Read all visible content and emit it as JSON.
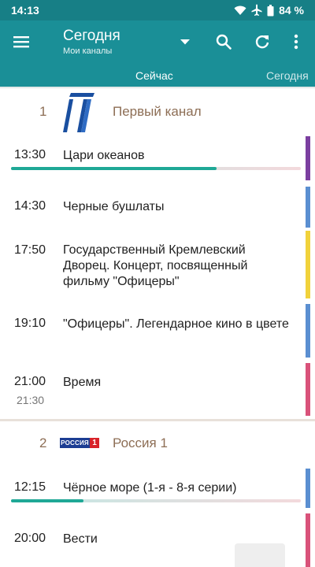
{
  "status_bar": {
    "time": "14:13",
    "battery": "84 %",
    "icons": [
      "wifi-icon",
      "airplane-icon",
      "battery-icon"
    ]
  },
  "app_bar": {
    "title": "Сегодня",
    "subtitle": "Мои каналы",
    "icons": [
      "menu-icon",
      "dropdown-icon",
      "search-icon",
      "refresh-icon",
      "more-icon"
    ]
  },
  "tabs": [
    {
      "label": "Сейчас",
      "selected": true
    },
    {
      "label": "Сегодня",
      "selected": false
    }
  ],
  "colors": {
    "appbar": "#1a8f97",
    "statusbar": "#177f86",
    "channel_text": "#8d6e55",
    "progress": "#1fa896",
    "cat_purple": "#7b3fa0",
    "cat_blue": "#5b8fd1",
    "cat_yellow": "#f1d23b",
    "cat_pink": "#d9527a"
  },
  "channels": [
    {
      "number": "1",
      "name": "Первый канал",
      "logo": "perviy-kanal-logo",
      "programs": [
        {
          "start": "13:30",
          "title": "Цари океанов",
          "progress": 0.71
        },
        {
          "start": "14:30",
          "title": "Черные бушлаты"
        },
        {
          "start": "17:50",
          "title": "Государственный Кремлевский Дворец. Концерт, посвященный фильму \"Офицеры\""
        },
        {
          "start": "19:10",
          "title": "\"Офицеры\". Легендарное кино в цвете"
        },
        {
          "start": "21:00",
          "end": "21:30",
          "title": "Время"
        }
      ]
    },
    {
      "number": "2",
      "name": "Россия 1",
      "logo": "rossiya-1-logo",
      "logo_text": {
        "word": "РОССИЯ",
        "digit": "1"
      },
      "programs": [
        {
          "start": "12:15",
          "title": "Чёрное море (1-я - 8-я серии)",
          "progress": 0.25
        },
        {
          "start": "20:00",
          "title": "Вести"
        }
      ]
    }
  ]
}
